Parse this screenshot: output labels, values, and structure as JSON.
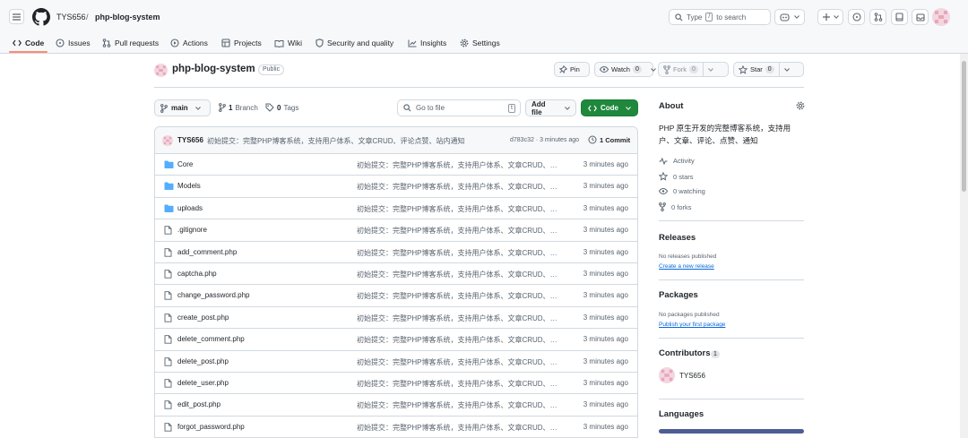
{
  "header": {
    "owner": "TYS656",
    "slash": "/",
    "repo": "php-blog-system",
    "search": {
      "prefix": "Type",
      "key": "/",
      "suffix": "to search"
    }
  },
  "tabs": [
    {
      "label": "Code",
      "icon": "code-icon"
    },
    {
      "label": "Issues",
      "icon": "issue-icon"
    },
    {
      "label": "Pull requests",
      "icon": "pull-request-icon"
    },
    {
      "label": "Actions",
      "icon": "play-icon"
    },
    {
      "label": "Projects",
      "icon": "table-icon"
    },
    {
      "label": "Wiki",
      "icon": "book-icon"
    },
    {
      "label": "Security and quality",
      "icon": "shield-icon"
    },
    {
      "label": "Insights",
      "icon": "graph-icon"
    },
    {
      "label": "Settings",
      "icon": "gear-icon"
    }
  ],
  "repo": {
    "name": "php-blog-system",
    "visibility": "Public",
    "pin": "Pin",
    "watch": "Watch",
    "watch_count": "0",
    "fork": "Fork",
    "fork_count": "0",
    "star": "Star",
    "star_count": "0"
  },
  "toolbar": {
    "branch": "main",
    "branch_count": "1",
    "branch_label": "Branch",
    "tag_count": "0",
    "tag_label": "Tags",
    "goto_placeholder": "Go to file",
    "goto_key": "t",
    "add_file": "Add file",
    "code": "Code"
  },
  "commit": {
    "author": "TYS656",
    "message": "初始提交：完整PHP博客系统，支持用户体系、文章CRUD、评论点赞、站内通知",
    "meta": "d783c32 · 3 minutes ago",
    "count": "1 Commit"
  },
  "files": [
    {
      "type": "dir",
      "name": "Core",
      "message": "初始提交：完整PHP博客系统，支持用户体系、文章CRUD、评论点赞、站内通知",
      "time": "3 minutes ago"
    },
    {
      "type": "dir",
      "name": "Models",
      "message": "初始提交：完整PHP博客系统，支持用户体系、文章CRUD、评论点赞、站内通知",
      "time": "3 minutes ago"
    },
    {
      "type": "dir",
      "name": "uploads",
      "message": "初始提交：完整PHP博客系统，支持用户体系、文章CRUD、评论点赞、站内通知",
      "time": "3 minutes ago"
    },
    {
      "type": "file",
      "name": ".gitignore",
      "message": "初始提交：完整PHP博客系统，支持用户体系、文章CRUD、评论点赞、站内通知",
      "time": "3 minutes ago"
    },
    {
      "type": "file",
      "name": "add_comment.php",
      "message": "初始提交：完整PHP博客系统，支持用户体系、文章CRUD、评论点赞、站内通知",
      "time": "3 minutes ago"
    },
    {
      "type": "file",
      "name": "captcha.php",
      "message": "初始提交：完整PHP博客系统，支持用户体系、文章CRUD、评论点赞、站内通知",
      "time": "3 minutes ago"
    },
    {
      "type": "file",
      "name": "change_password.php",
      "message": "初始提交：完整PHP博客系统，支持用户体系、文章CRUD、评论点赞、站内通知",
      "time": "3 minutes ago"
    },
    {
      "type": "file",
      "name": "create_post.php",
      "message": "初始提交：完整PHP博客系统，支持用户体系、文章CRUD、评论点赞、站内通知",
      "time": "3 minutes ago"
    },
    {
      "type": "file",
      "name": "delete_comment.php",
      "message": "初始提交：完整PHP博客系统，支持用户体系、文章CRUD、评论点赞、站内通知",
      "time": "3 minutes ago"
    },
    {
      "type": "file",
      "name": "delete_post.php",
      "message": "初始提交：完整PHP博客系统，支持用户体系、文章CRUD、评论点赞、站内通知",
      "time": "3 minutes ago"
    },
    {
      "type": "file",
      "name": "delete_user.php",
      "message": "初始提交：完整PHP博客系统，支持用户体系、文章CRUD、评论点赞、站内通知",
      "time": "3 minutes ago"
    },
    {
      "type": "file",
      "name": "edit_post.php",
      "message": "初始提交：完整PHP博客系统，支持用户体系、文章CRUD、评论点赞、站内通知",
      "time": "3 minutes ago"
    },
    {
      "type": "file",
      "name": "forgot_password.php",
      "message": "初始提交：完整PHP博客系统，支持用户体系、文章CRUD、评论点赞、站内通知",
      "time": "3 minutes ago"
    }
  ],
  "about": {
    "title": "About",
    "description": "PHP 原生开发的完整博客系统，支持用户、文章、评论、点赞、通知",
    "stats": [
      {
        "icon": "pulse-icon",
        "label": "Activity"
      },
      {
        "icon": "star-icon",
        "label": "0 stars"
      },
      {
        "icon": "eye-icon",
        "label": "0 watching"
      },
      {
        "icon": "fork-icon",
        "label": "0 forks"
      }
    ]
  },
  "releases": {
    "title": "Releases",
    "empty": "No releases published",
    "link": "Create a new release"
  },
  "packages": {
    "title": "Packages",
    "empty": "No packages published",
    "link": "Publish your first package"
  },
  "contributors": {
    "title": "Contributors",
    "count": "1",
    "name": "TYS656"
  },
  "languages": {
    "title": "Languages"
  },
  "colors": {
    "accent": "#1f883d",
    "tab_underline": "#fd8c73",
    "folder": "#54aeff",
    "link": "#0969da",
    "language_bar": "#4f5d95"
  }
}
